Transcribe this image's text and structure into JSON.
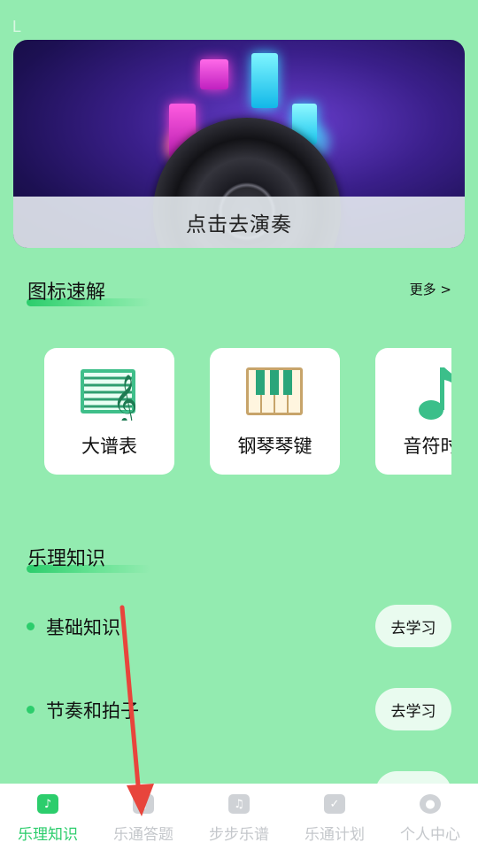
{
  "status": {
    "mark": "L"
  },
  "banner": {
    "caption": "点击去演奏"
  },
  "icons_section": {
    "title": "图标速解",
    "more": "更多 >",
    "cards": [
      {
        "label": "大谱表",
        "icon": "staff-icon"
      },
      {
        "label": "钢琴琴键",
        "icon": "piano-keys-icon"
      },
      {
        "label": "音符时值",
        "icon": "music-note-icon"
      }
    ]
  },
  "theory_section": {
    "title": "乐理知识",
    "items": [
      {
        "label": "基础知识",
        "button": "去学习"
      },
      {
        "label": "节奏和拍子",
        "button": "去学习"
      }
    ]
  },
  "nav": {
    "items": [
      {
        "label": "乐理知识",
        "icon": "note-icon",
        "active": true
      },
      {
        "label": "乐通答题",
        "icon": "quiz-icon",
        "active": false
      },
      {
        "label": "步步乐谱",
        "icon": "music-icon",
        "active": false
      },
      {
        "label": "乐通计划",
        "icon": "plan-icon",
        "active": false
      },
      {
        "label": "个人中心",
        "icon": "person-icon",
        "active": false
      }
    ]
  },
  "colors": {
    "background": "#93ebb0",
    "accent": "#2ccd6c",
    "annotation_arrow": "#e8453c"
  }
}
